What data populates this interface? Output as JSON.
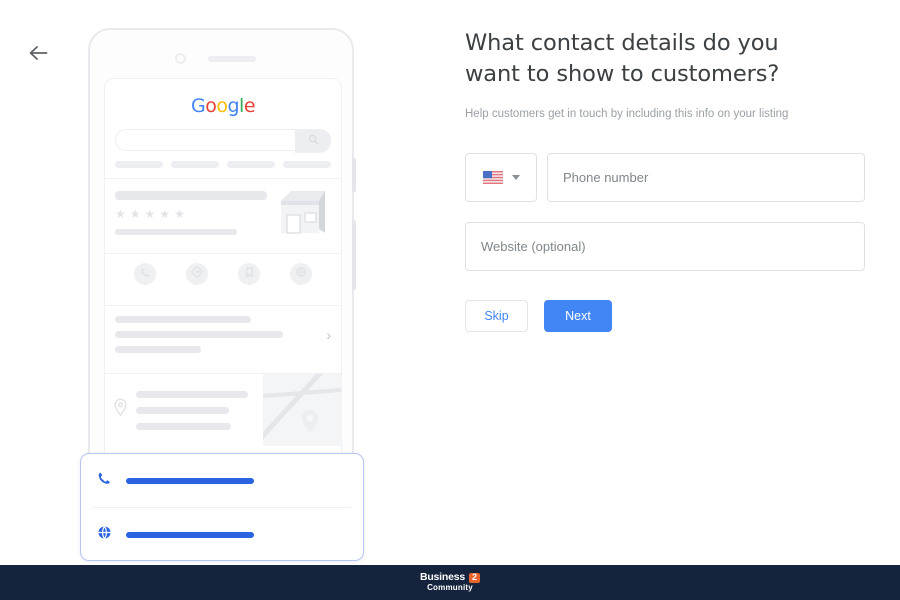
{
  "nav": {
    "back_icon": "arrow-left-icon"
  },
  "headline": "What contact details do you want to show to customers?",
  "subhead": "Help customers get in touch by including this info on your listing",
  "form": {
    "country_select": {
      "flag": "us-flag-icon",
      "caret": "chevron-down-icon"
    },
    "phone": {
      "value": "",
      "placeholder": "Phone number"
    },
    "website": {
      "value": "",
      "placeholder": "Website (optional)"
    }
  },
  "buttons": {
    "skip": "Skip",
    "next": "Next"
  },
  "phone_mockup": {
    "google_logo": {
      "g1": "G",
      "o1": "o",
      "o2": "o",
      "g2": "g",
      "l": "l",
      "e": "e"
    },
    "search_icon": "search-icon",
    "store_icon": "storefront-icon",
    "star_glyph": "★",
    "star_count": 5,
    "chevron": "›",
    "actions": [
      {
        "name": "call-icon"
      },
      {
        "name": "directions-icon"
      },
      {
        "name": "save-icon"
      },
      {
        "name": "website-icon"
      }
    ],
    "pin_icon": "location-pin-icon",
    "clock_icon": "clock-icon",
    "map_pin_icon": "map-pin-icon"
  },
  "callout": {
    "rows": [
      {
        "icon": "phone-icon"
      },
      {
        "icon": "globe-icon"
      }
    ]
  },
  "footer": {
    "brand_word": "Business",
    "brand_badge": "2",
    "brand_sub": "Community"
  },
  "colors": {
    "google_blue": "#4285f4",
    "google_red": "#ea4335",
    "google_yellow": "#fbbc05",
    "google_green": "#34a853",
    "accent_blue": "#2b63e0",
    "footer_navy": "#16233d",
    "badge_orange": "#e8622c"
  }
}
